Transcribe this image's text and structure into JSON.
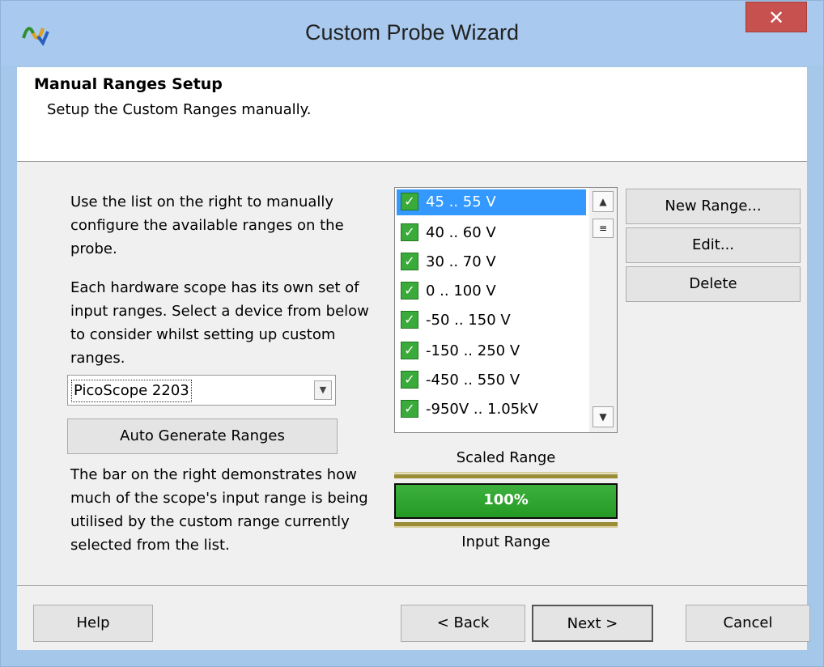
{
  "window": {
    "title": "Custom Probe Wizard",
    "close_glyph": "✕"
  },
  "header": {
    "title": "Manual Ranges Setup",
    "subtitle": "Setup the Custom Ranges manually."
  },
  "left": {
    "para1": "Use the list on the right to manually configure the available ranges on the probe.",
    "para2": "Each hardware scope has its own set of input ranges. Select a device from below to consider whilst setting up custom ranges.",
    "device_selected": "PicoScope 2203",
    "auto_generate_label": "Auto Generate Ranges",
    "para3": "The bar on the right demonstrates how much of the scope's input range is being utilised by the custom range currently selected from the list."
  },
  "ranges": {
    "items": [
      {
        "label": "45 .. 55 V",
        "checked": true,
        "selected": true
      },
      {
        "label": "40 .. 60 V",
        "checked": true,
        "selected": false
      },
      {
        "label": "30 .. 70 V",
        "checked": true,
        "selected": false
      },
      {
        "label": "0 .. 100 V",
        "checked": true,
        "selected": false
      },
      {
        "label": "-50 .. 150 V",
        "checked": true,
        "selected": false
      },
      {
        "label": "-150 .. 250 V",
        "checked": true,
        "selected": false
      },
      {
        "label": "-450 .. 550 V",
        "checked": true,
        "selected": false
      },
      {
        "label": "-950V .. 1.05kV",
        "checked": true,
        "selected": false
      }
    ]
  },
  "buttons": {
    "new_range": "New Range...",
    "edit": "Edit...",
    "delete": "Delete"
  },
  "usage": {
    "scaled_label": "Scaled Range",
    "percent_text": "100%",
    "fraction": 1.0,
    "input_label": "Input Range"
  },
  "footer": {
    "help": "Help",
    "back": "< Back",
    "next": "Next >",
    "cancel": "Cancel"
  },
  "colors": {
    "titlebar": "#a9caee",
    "close": "#c7514f",
    "bar_fill": "#2fa52f",
    "selection": "#3399ff"
  }
}
